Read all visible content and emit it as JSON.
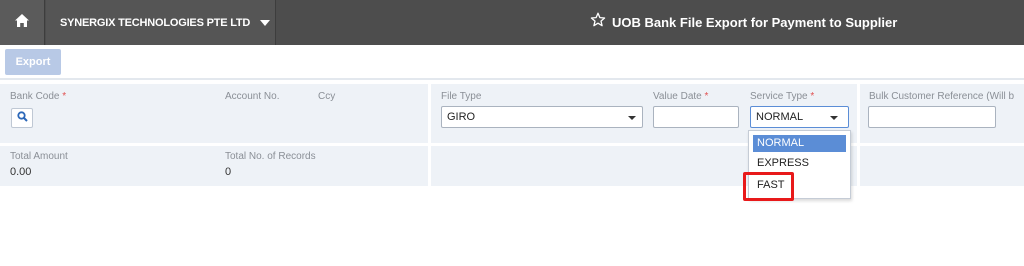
{
  "header": {
    "company": "SYNERGIX TECHNOLOGIES PTE LTD",
    "title": "UOB Bank File Export for Payment to Supplier",
    "icons": [
      "home-icon",
      "chevron-down-icon",
      "star-icon"
    ]
  },
  "toolbar": {
    "export_label": "Export"
  },
  "form": {
    "bank_code_label": "Bank Code",
    "account_no_label": "Account No.",
    "ccy_label": "Ccy",
    "file_type_label": "File Type",
    "file_type_value": "GIRO",
    "value_date_label": "Value Date",
    "value_date_value": "",
    "service_type_label": "Service Type",
    "service_type_value": "NORMAL",
    "bulk_ref_label": "Bulk Customer Reference (Will b",
    "bulk_ref_value": "",
    "required_mark": "*",
    "total_amount_label": "Total Amount",
    "total_amount_value": "0.00",
    "total_records_label": "Total No. of Records",
    "total_records_value": "0"
  },
  "service_type_options": [
    {
      "label": "NORMAL",
      "selected": true
    },
    {
      "label": "EXPRESS",
      "selected": false
    },
    {
      "label": "FAST",
      "selected": false
    }
  ],
  "colors": {
    "header_bg": "#4d4d4d",
    "panel_bg": "#eef2f7",
    "export_button": "#b8c9e6",
    "option_selected": "#5b8dd6",
    "annotation": "#e8191a"
  }
}
